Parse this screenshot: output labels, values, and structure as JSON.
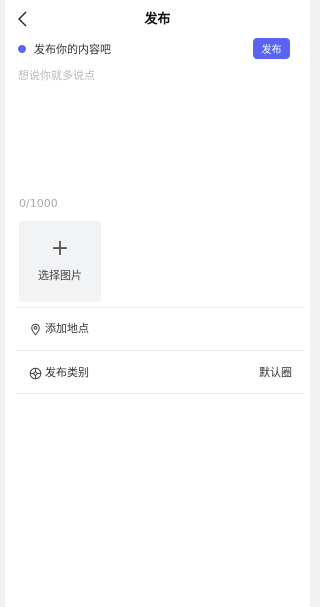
{
  "nav": {
    "back_icon": "chevron-left-icon",
    "title": "发布"
  },
  "compose": {
    "prompt": "发布你的内容吧",
    "publish_label": "发布",
    "placeholder": "想说你就多说点",
    "value": "",
    "counter": "0/1000",
    "accent_color": "#5b64f2"
  },
  "upload": {
    "plus": "+",
    "label": "选择图片"
  },
  "options": {
    "location": {
      "icon": "location-pin-icon",
      "label": "添加地点"
    },
    "category": {
      "icon": "category-icon",
      "label": "发布类别",
      "value": "默认圈"
    }
  }
}
